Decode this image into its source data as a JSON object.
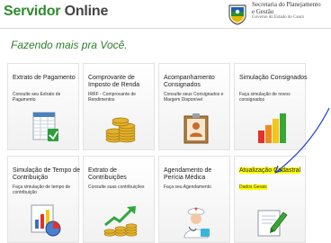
{
  "header": {
    "brand_word_1": "Servidor",
    "brand_word_2": "Online",
    "org_line_1": "Secretaria do Planejamento",
    "org_line_2": "e Gestão",
    "org_line_3": "Governo do Estado do Ceará"
  },
  "tagline": "Fazendo mais pra Você.",
  "tiles": [
    {
      "title": "Extrato de Pagamento",
      "desc": "Consulte seu Extrato de Pagamento",
      "icon": "spreadsheet-icon"
    },
    {
      "title": "Comprovante de Imposto de Renda",
      "desc": "IRRF - Comprovante de Rendimentos",
      "icon": "coin-stack-icon"
    },
    {
      "title": "Acompanhamento Consignados",
      "desc": "Consulte seus Consignados e Margem Disponível",
      "icon": "folder-person-icon"
    },
    {
      "title": "Simulação Consignados",
      "desc": "Faça simulação de novos consignados",
      "icon": "bar-chart-icon"
    },
    {
      "title": "Simulação de Tempo de Contribuição",
      "desc": "Faça simulação de tempo de contribuição",
      "icon": "report-chart-icon"
    },
    {
      "title": "Extrato de Contribuições",
      "desc": "Consulte suas contribuições",
      "icon": "growth-arrow-icon"
    },
    {
      "title": "Agendamento de Perícia Médica",
      "desc": "Faça seu Agendamento",
      "icon": "nurse-icon"
    },
    {
      "title": "Atualização Cadastral",
      "desc": "Dados Gerais",
      "icon": "edit-document-icon"
    }
  ],
  "colors": {
    "brand_green": "#2e8b2e",
    "highlight": "#ffff00",
    "annotation_blue": "#1f3fd6"
  }
}
